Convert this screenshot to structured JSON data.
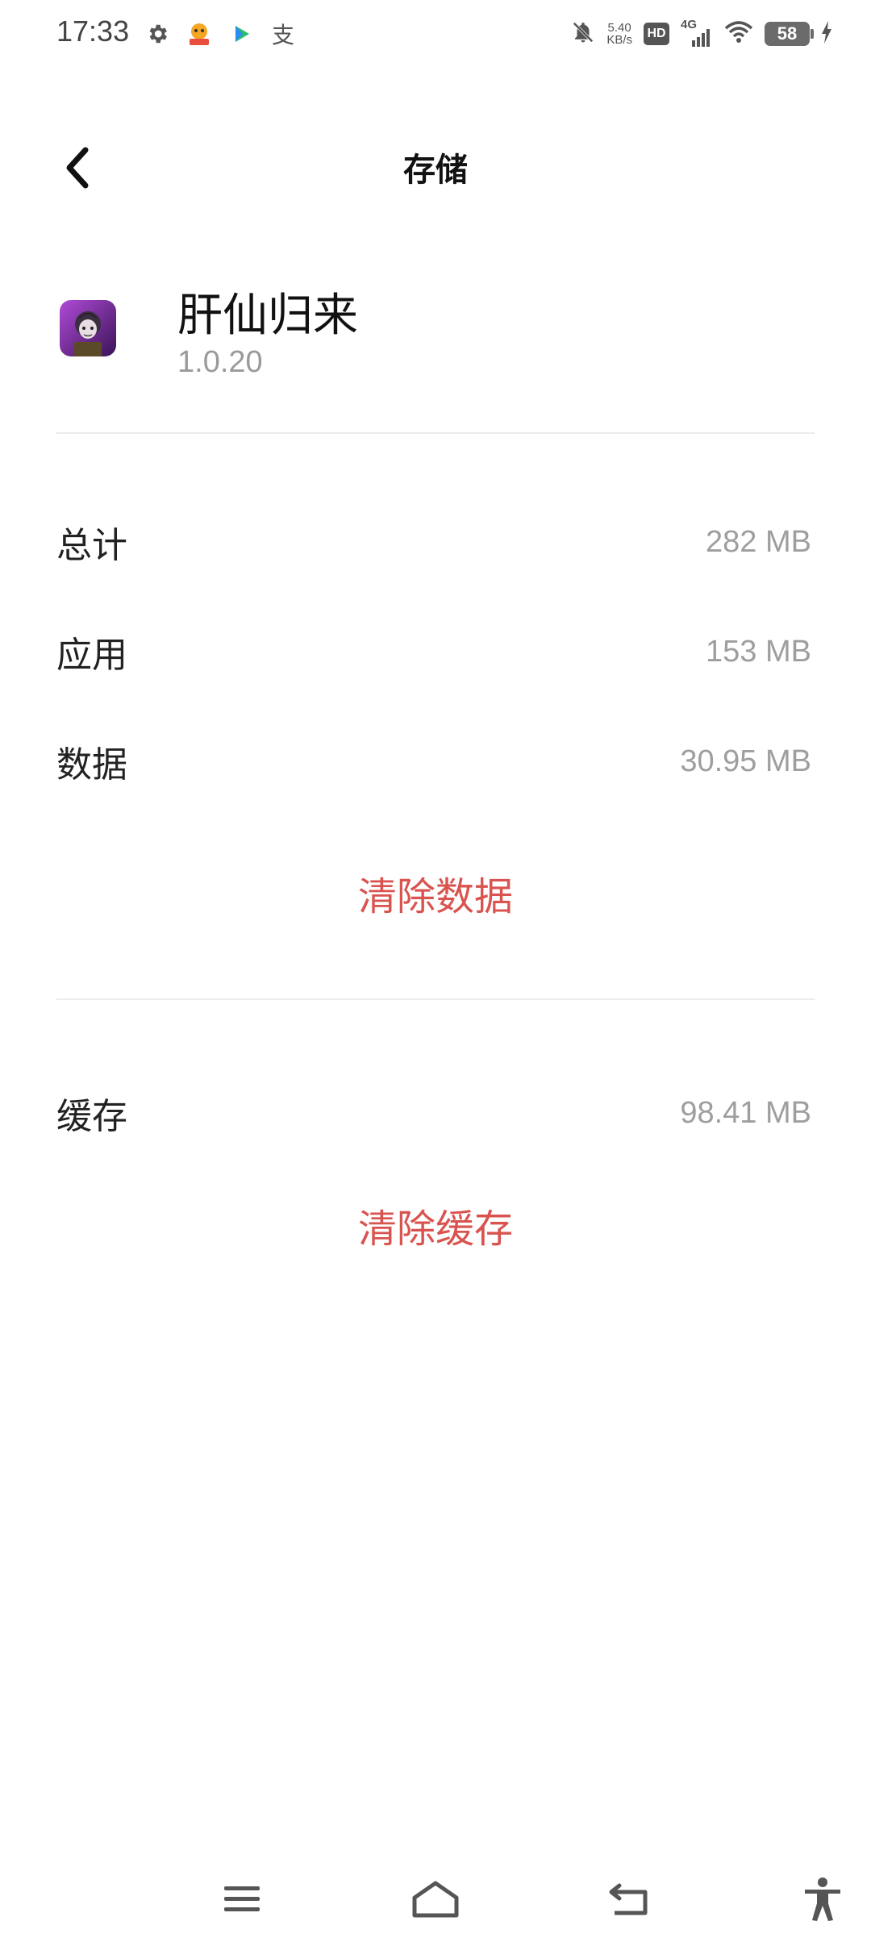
{
  "status_bar": {
    "time": "17:33",
    "net_speed_value": "5.40",
    "net_speed_unit": "KB/s",
    "hd_label": "HD",
    "network_label": "4G",
    "battery_level": "58",
    "left_icons": [
      "gear-icon",
      "app-notification-icon",
      "video-app-icon",
      "alipay-icon"
    ],
    "alipay_glyph": "支"
  },
  "header": {
    "title": "存储"
  },
  "app": {
    "name": "肝仙归来",
    "version": "1.0.20"
  },
  "storage": {
    "total_label": "总计",
    "total_value": "282 MB",
    "app_label": "应用",
    "app_value": "153 MB",
    "data_label": "数据",
    "data_value": "30.95 MB",
    "clear_data_label": "清除数据",
    "cache_label": "缓存",
    "cache_value": "98.41 MB",
    "clear_cache_label": "清除缓存"
  },
  "nav_bar": {
    "icons": [
      "menu-icon",
      "home-icon",
      "back-nav-icon",
      "accessibility-icon"
    ]
  },
  "colors": {
    "accent_red": "#d9534f",
    "muted_text": "#9e9e9e",
    "divider": "#ececec"
  }
}
